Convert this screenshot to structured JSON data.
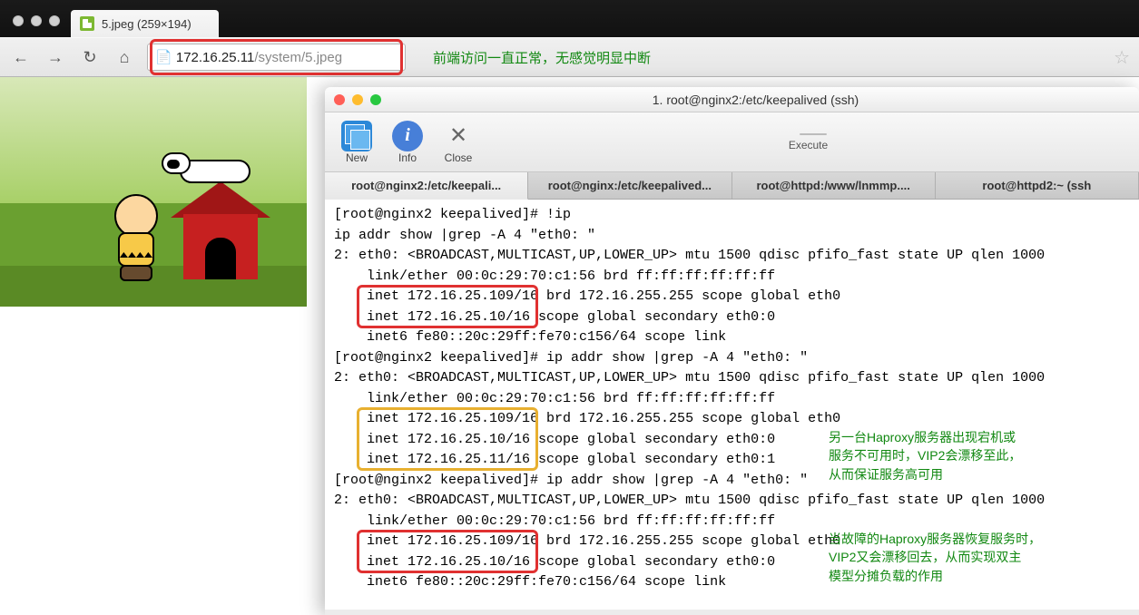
{
  "browser": {
    "tab_title": "5.jpeg (259×194)",
    "url_host": "172.16.25.11",
    "url_path": "/system/5.jpeg",
    "annotation": "前端访问一直正常，无感觉明显中断"
  },
  "terminal": {
    "title": "1. root@nginx2:/etc/keepalived (ssh)",
    "toolbar": {
      "new": "New",
      "info": "Info",
      "close": "Close",
      "execute": "Execute"
    },
    "tabs": [
      "root@nginx2:/etc/keepali...",
      "root@nginx:/etc/keepalived...",
      "root@httpd:/www/lnmmp....",
      "root@httpd2:~ (ssh"
    ],
    "lines": [
      "[root@nginx2 keepalived]# !ip",
      "ip addr show |grep -A 4 \"eth0: \"",
      "2: eth0: <BROADCAST,MULTICAST,UP,LOWER_UP> mtu 1500 qdisc pfifo_fast state UP qlen 1000",
      "    link/ether 00:0c:29:70:c1:56 brd ff:ff:ff:ff:ff:ff",
      "    inet 172.16.25.109/16 brd 172.16.255.255 scope global eth0",
      "    inet 172.16.25.10/16 scope global secondary eth0:0",
      "    inet6 fe80::20c:29ff:fe70:c156/64 scope link",
      "[root@nginx2 keepalived]# ip addr show |grep -A 4 \"eth0: \"",
      "2: eth0: <BROADCAST,MULTICAST,UP,LOWER_UP> mtu 1500 qdisc pfifo_fast state UP qlen 1000",
      "    link/ether 00:0c:29:70:c1:56 brd ff:ff:ff:ff:ff:ff",
      "    inet 172.16.25.109/16 brd 172.16.255.255 scope global eth0",
      "    inet 172.16.25.10/16 scope global secondary eth0:0",
      "    inet 172.16.25.11/16 scope global secondary eth0:1",
      "[root@nginx2 keepalived]# ip addr show |grep -A 4 \"eth0: \"",
      "2: eth0: <BROADCAST,MULTICAST,UP,LOWER_UP> mtu 1500 qdisc pfifo_fast state UP qlen 1000",
      "    link/ether 00:0c:29:70:c1:56 brd ff:ff:ff:ff:ff:ff",
      "    inet 172.16.25.109/16 brd 172.16.255.255 scope global eth0",
      "    inet 172.16.25.10/16 scope global secondary eth0:0",
      "    inet6 fe80::20c:29ff:fe70:c156/64 scope link"
    ],
    "notes": {
      "n1_l1": "另一台Haproxy服务器出现宕机或",
      "n1_l2": "服务不可用时，VIP2会漂移至此，",
      "n1_l3": "从而保证服务高可用",
      "n2_l1": "当故障的Haproxy服务器恢复服务时，",
      "n2_l2": "VIP2又会漂移回去，从而实现双主",
      "n2_l3": "模型分摊负载的作用"
    }
  }
}
